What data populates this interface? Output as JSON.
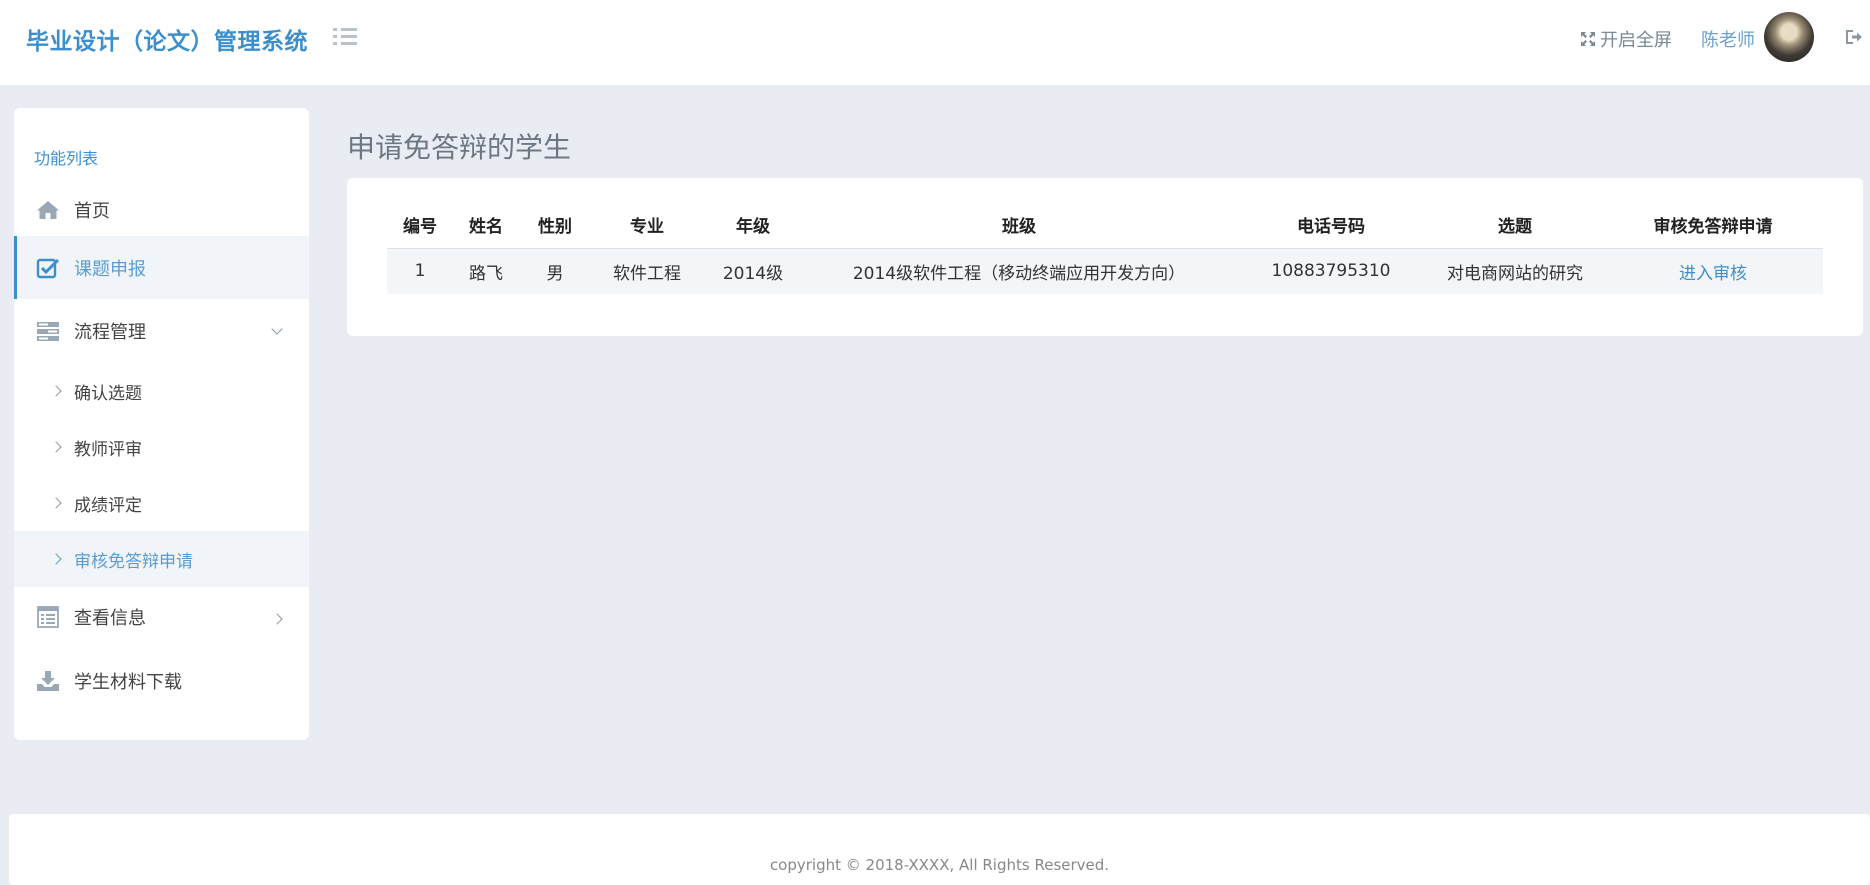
{
  "header": {
    "brand": "毕业设计（论文）管理系统",
    "fullscreen_label": "开启全屏",
    "user_name": "陈老师"
  },
  "sidebar": {
    "title": "功能列表",
    "items": [
      {
        "label": "首页",
        "icon": "home-icon"
      },
      {
        "label": "课题申报",
        "icon": "checkbox-icon",
        "active": true
      },
      {
        "label": "流程管理",
        "icon": "process-icon",
        "expanded": true
      },
      {
        "label": "查看信息",
        "icon": "info-icon"
      },
      {
        "label": "学生材料下载",
        "icon": "download-icon"
      }
    ],
    "sub_items": [
      {
        "label": "确认选题"
      },
      {
        "label": "教师评审"
      },
      {
        "label": "成绩评定"
      },
      {
        "label": "审核免答辩申请",
        "active": true
      }
    ]
  },
  "main": {
    "title": "申请免答辩的学生",
    "table": {
      "headers": [
        "编号",
        "姓名",
        "性别",
        "专业",
        "年级",
        "班级",
        "电话号码",
        "选题",
        "审核免答辩申请"
      ],
      "rows": [
        [
          "1",
          "路飞",
          "男",
          "软件工程",
          "2014级",
          "2014级软件工程（移动终端应用开发方向）",
          "10883795310",
          "对电商网站的研究",
          "进入审核"
        ]
      ]
    }
  },
  "footer": {
    "copyright": "copyright © 2018-XXXX, All Rights Reserved."
  },
  "colors": {
    "accent": "#3d8fcc",
    "background": "#e9ecf3",
    "active_bg": "#f1f4f8"
  }
}
